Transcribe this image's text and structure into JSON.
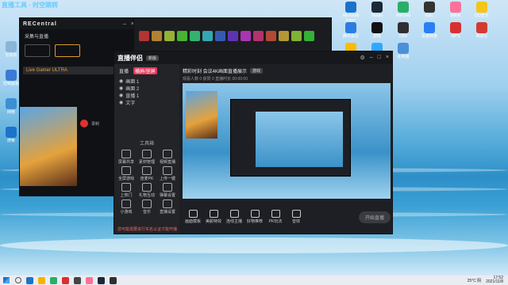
{
  "overlay": {
    "title": "直播工具 · 时空跳转"
  },
  "desktop_icons_right": [
    {
      "label": "Microsoft Edge",
      "color": "#1a73c9"
    },
    {
      "label": "Steam",
      "color": "#1b2838"
    },
    {
      "label": "WeChat",
      "color": "#2aae67"
    },
    {
      "label": "Epic",
      "color": "#333"
    },
    {
      "label": "Bilibili",
      "color": "#fb7299"
    },
    {
      "label": "QQ音乐",
      "color": "#f5c518"
    },
    {
      "label": "腾讯会议",
      "color": "#2a7de1"
    },
    {
      "label": "剪映",
      "color": "#111"
    },
    {
      "label": "OBS",
      "color": "#302e31"
    },
    {
      "label": "百度网盘",
      "color": "#2b7ff6"
    },
    {
      "label": "WPS",
      "color": "#d8302f"
    },
    {
      "label": "网易云",
      "color": "#d33a31"
    },
    {
      "label": "Chrome",
      "color": "#fbbc04"
    },
    {
      "label": "Photoshop",
      "color": "#31a8ff"
    },
    {
      "label": "此电脑",
      "color": "#4a90d9"
    }
  ],
  "desktop_icons_left": [
    {
      "label": "回收站",
      "color": "#8ab4d8"
    },
    {
      "label": "控制面板",
      "color": "#3a7bd5"
    },
    {
      "label": "网络",
      "color": "#3c8fd3"
    },
    {
      "label": "搜索",
      "color": "#1d73c9"
    }
  ],
  "recentral": {
    "brand": "RECentral",
    "mode_label": "采集与直播",
    "device": "Live Gamer ULTRA",
    "record_label": "录制"
  },
  "main": {
    "logo": "直播伴侣",
    "badge": "新版",
    "tabs": [
      "直播",
      "横屏/竖屏"
    ],
    "scene_list": [
      "画面 1",
      "画面 2",
      "直播 1",
      "文字"
    ],
    "stream_title": "精彩时刻 会议4K画面直播展示",
    "stream_tag": "游戏",
    "stream_stats": "观看人数 0  获赞 0  直播时长 00:00:00",
    "section_label": "工具箱",
    "tools": [
      "屏幕共享",
      "素材管理",
      "视频直播",
      "全屏游戏",
      "连麦PK",
      "上传一键",
      "上热门",
      "礼物互动",
      "弹幕设置",
      "小游戏",
      "音乐",
      "直播设置"
    ],
    "bottom_buttons": [
      "画面模板",
      "美颜特效",
      "连线主播",
      "好物推荐",
      "PK玩法",
      "音效"
    ],
    "live_button": "开始直播",
    "notice": "您可能需要进行实名认证才能开播"
  },
  "taskbar": {
    "weather": "25°C 阴",
    "time": "17:52",
    "date": "2021/11/8",
    "app_colors": [
      "#1d73c9",
      "#f2b600",
      "#2aae67",
      "#d8302f",
      "#444",
      "#fb7299",
      "#1b2838",
      "#302e31"
    ]
  }
}
